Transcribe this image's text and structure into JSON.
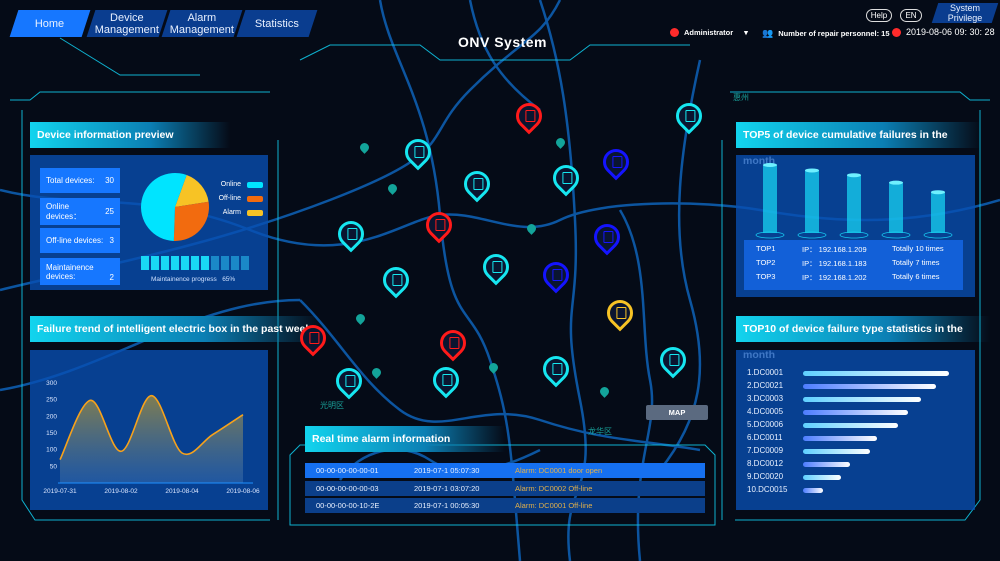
{
  "nav": {
    "items": [
      {
        "label": "Home",
        "active": true
      },
      {
        "label": "Device Management"
      },
      {
        "label": "Alarm Management"
      },
      {
        "label": "Statistics"
      }
    ]
  },
  "header": {
    "title": "ONV System",
    "help": "Help",
    "lang": "EN",
    "privilege": "System Privilege",
    "user": "Administrator",
    "repair": "Number of repair personnel: 15",
    "datetime": "2019-08-06 09: 30: 28",
    "icons": [
      "user-icon",
      "chevron-down-icon",
      "people-icon",
      "clock-icon"
    ]
  },
  "device_preview": {
    "title": "Device information preview",
    "stats": [
      {
        "label": "Total devices:",
        "value": "30"
      },
      {
        "label": "Online devices：",
        "value": "25"
      },
      {
        "label": "Off-line devices:",
        "value": "3"
      },
      {
        "label": "Maintainence devices:",
        "value": "2"
      }
    ],
    "pie": [
      {
        "name": "Online",
        "color": "#00e4ff",
        "percent": 55
      },
      {
        "name": "Off-line",
        "color": "#f26b0f",
        "percent": 28
      },
      {
        "name": "Alarm",
        "color": "#f7c325",
        "percent": 17
      }
    ],
    "progress_label": "Maintainence progress",
    "progress": "65%",
    "progress_value": 65
  },
  "trend": {
    "title": "Failure trend of intelligent electric box in the past week",
    "chart_data": {
      "type": "area",
      "x": [
        "2019-07-31",
        "2019-08-01",
        "2019-08-02",
        "2019-08-03",
        "2019-08-04",
        "2019-08-05",
        "2019-08-06"
      ],
      "values": [
        70,
        248,
        95,
        262,
        90,
        145,
        205
      ],
      "xticks": [
        "2019-07-31",
        "2019-08-02",
        "2019-08-04",
        "2019-08-06"
      ],
      "yticks": [
        "50",
        "100",
        "150",
        "200",
        "250",
        "300"
      ],
      "ylim": [
        0,
        300
      ],
      "color": "#f7a21b"
    }
  },
  "top5": {
    "title": "TOP5 of device cumulative failures in the month",
    "chart_data": {
      "type": "bar",
      "values": [
        10,
        9.2,
        8.5,
        7.4,
        6
      ]
    },
    "rows": [
      {
        "rank": "TOP1",
        "ip": "IP：  192.168.1.209",
        "count": "Totally 10 times"
      },
      {
        "rank": "TOP2",
        "ip": "IP：  192.168.1.183",
        "count": "Totally 7 times"
      },
      {
        "rank": "TOP3",
        "ip": "IP：  192.168.1.202",
        "count": "Totally 6 times"
      }
    ]
  },
  "top10": {
    "title": "TOP10 of device failure type statistics in the month",
    "chart_data": {
      "type": "bar",
      "categories": [
        "1.DC0001",
        "2.DC0021",
        "3.DC0003",
        "4.DC0005",
        "5.DC0006",
        "6.DC0011",
        "7.DC0009",
        "8.DC0012",
        "9.DC0020",
        "10.DC0015"
      ],
      "values": [
        100,
        91,
        81,
        72,
        65,
        51,
        46,
        32,
        26,
        14
      ]
    }
  },
  "alarm": {
    "title": "Real time alarm information",
    "rows": [
      {
        "id": "00-00-00-00-00-01",
        "time": "2019-07-1 05:07:30",
        "msg": "Alarm: DC0001 door open"
      },
      {
        "id": "00-00-00-00-00-03",
        "time": "2019-07-1 03:07:20",
        "msg": "Alarm: DC0002 Off-line"
      },
      {
        "id": "00-00-00-00-10-2E",
        "time": "2019-07-1 00:05:30",
        "msg": "Alarm: DC0001 Off-line"
      }
    ]
  },
  "map": {
    "button": "MAP",
    "districts": [
      "光明区",
      "龙华区",
      "惠州"
    ],
    "pin_colors": {
      "normal": "#16e6f0",
      "alarm": "#ff1a1a",
      "offline": "#1414ff",
      "warning": "#f7c325",
      "poi": "#13a49a"
    }
  }
}
